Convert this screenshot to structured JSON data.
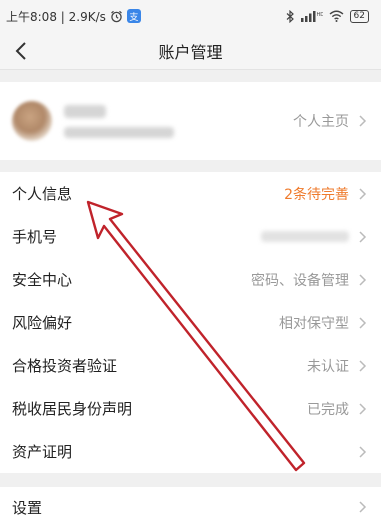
{
  "status_bar": {
    "time_speed": "上午8:08 | 2.9K/s",
    "signal": "HD",
    "battery": "62"
  },
  "nav": {
    "title": "账户管理"
  },
  "profile": {
    "link_label": "个人主页"
  },
  "rows": [
    {
      "label": "个人信息",
      "value": "2条待完善",
      "accent": true
    },
    {
      "label": "手机号",
      "value": "",
      "blurred": true
    },
    {
      "label": "安全中心",
      "value": "密码、设备管理"
    },
    {
      "label": "风险偏好",
      "value": "相对保守型"
    },
    {
      "label": "合格投资者验证",
      "value": "未认证"
    },
    {
      "label": "税收居民身份声明",
      "value": "已完成"
    },
    {
      "label": "资产证明",
      "value": ""
    }
  ],
  "settings": {
    "label": "设置"
  },
  "colors": {
    "accent": "#ef7b2d",
    "annotation_arrow": "#c0232b"
  }
}
